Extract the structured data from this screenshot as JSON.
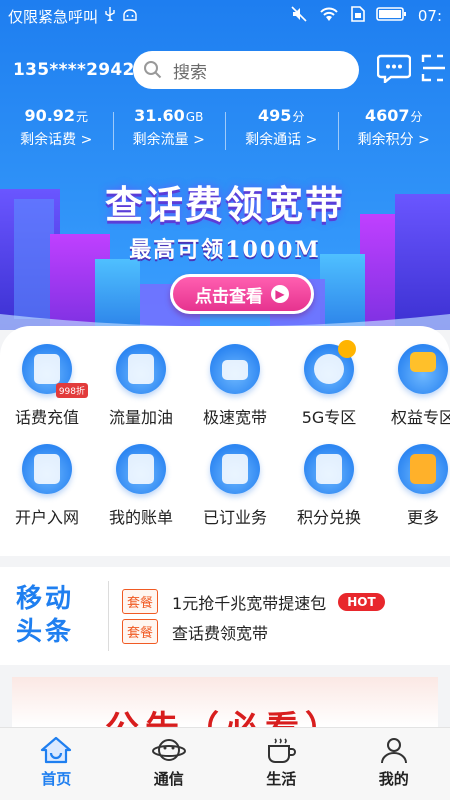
{
  "status_bar": {
    "left_text": "仅限紧急呼叫",
    "time": "07:"
  },
  "header": {
    "phone": "135****2942",
    "search_placeholder": "搜索"
  },
  "stats": [
    {
      "value": "90.92",
      "unit": "元",
      "label": "剩余话费 >"
    },
    {
      "value": "31.60",
      "unit": "GB",
      "label": "剩余流量 >"
    },
    {
      "value": "495",
      "unit": "分",
      "label": "剩余通话 >"
    },
    {
      "value": "4607",
      "unit": "分",
      "label": "剩余积分 >"
    }
  ],
  "banner": {
    "title": "查话费领宽带",
    "subtitle": "最高可领1000M",
    "button": "点击查看"
  },
  "services": [
    {
      "label": "话费充值",
      "icon": "wallet-icon",
      "badge": "998折"
    },
    {
      "label": "流量加油",
      "icon": "phone-data-icon"
    },
    {
      "label": "极速宽带",
      "icon": "router-icon"
    },
    {
      "label": "5G专区",
      "icon": "5g-icon"
    },
    {
      "label": "权益专区",
      "icon": "diamond-icon"
    },
    {
      "label": "开户入网",
      "icon": "sim-card-icon"
    },
    {
      "label": "我的账单",
      "icon": "bill-icon"
    },
    {
      "label": "已订业务",
      "icon": "subscription-icon"
    },
    {
      "label": "积分兑换",
      "icon": "gift-icon"
    },
    {
      "label": "更多",
      "icon": "more-icon"
    }
  ],
  "news": {
    "logo_line1": "移动",
    "logo_line2": "头条",
    "items": [
      {
        "tag": "套餐",
        "text": "1元抢千兆宽带提速包",
        "badge": "HOT"
      },
      {
        "tag": "套餐",
        "text": "查话费领宽带"
      }
    ]
  },
  "notice": {
    "title": "公告（必看）"
  },
  "tabs": [
    {
      "label": "首页",
      "icon": "home-icon",
      "active": true
    },
    {
      "label": "通信",
      "icon": "planet-icon"
    },
    {
      "label": "生活",
      "icon": "coffee-cup-icon"
    },
    {
      "label": "我的",
      "icon": "user-icon"
    }
  ],
  "colors": {
    "brand_blue": "#1f7ff0",
    "banner_button": "#e6338f",
    "hot_red": "#e8272c",
    "tag_orange": "#f05a23"
  }
}
